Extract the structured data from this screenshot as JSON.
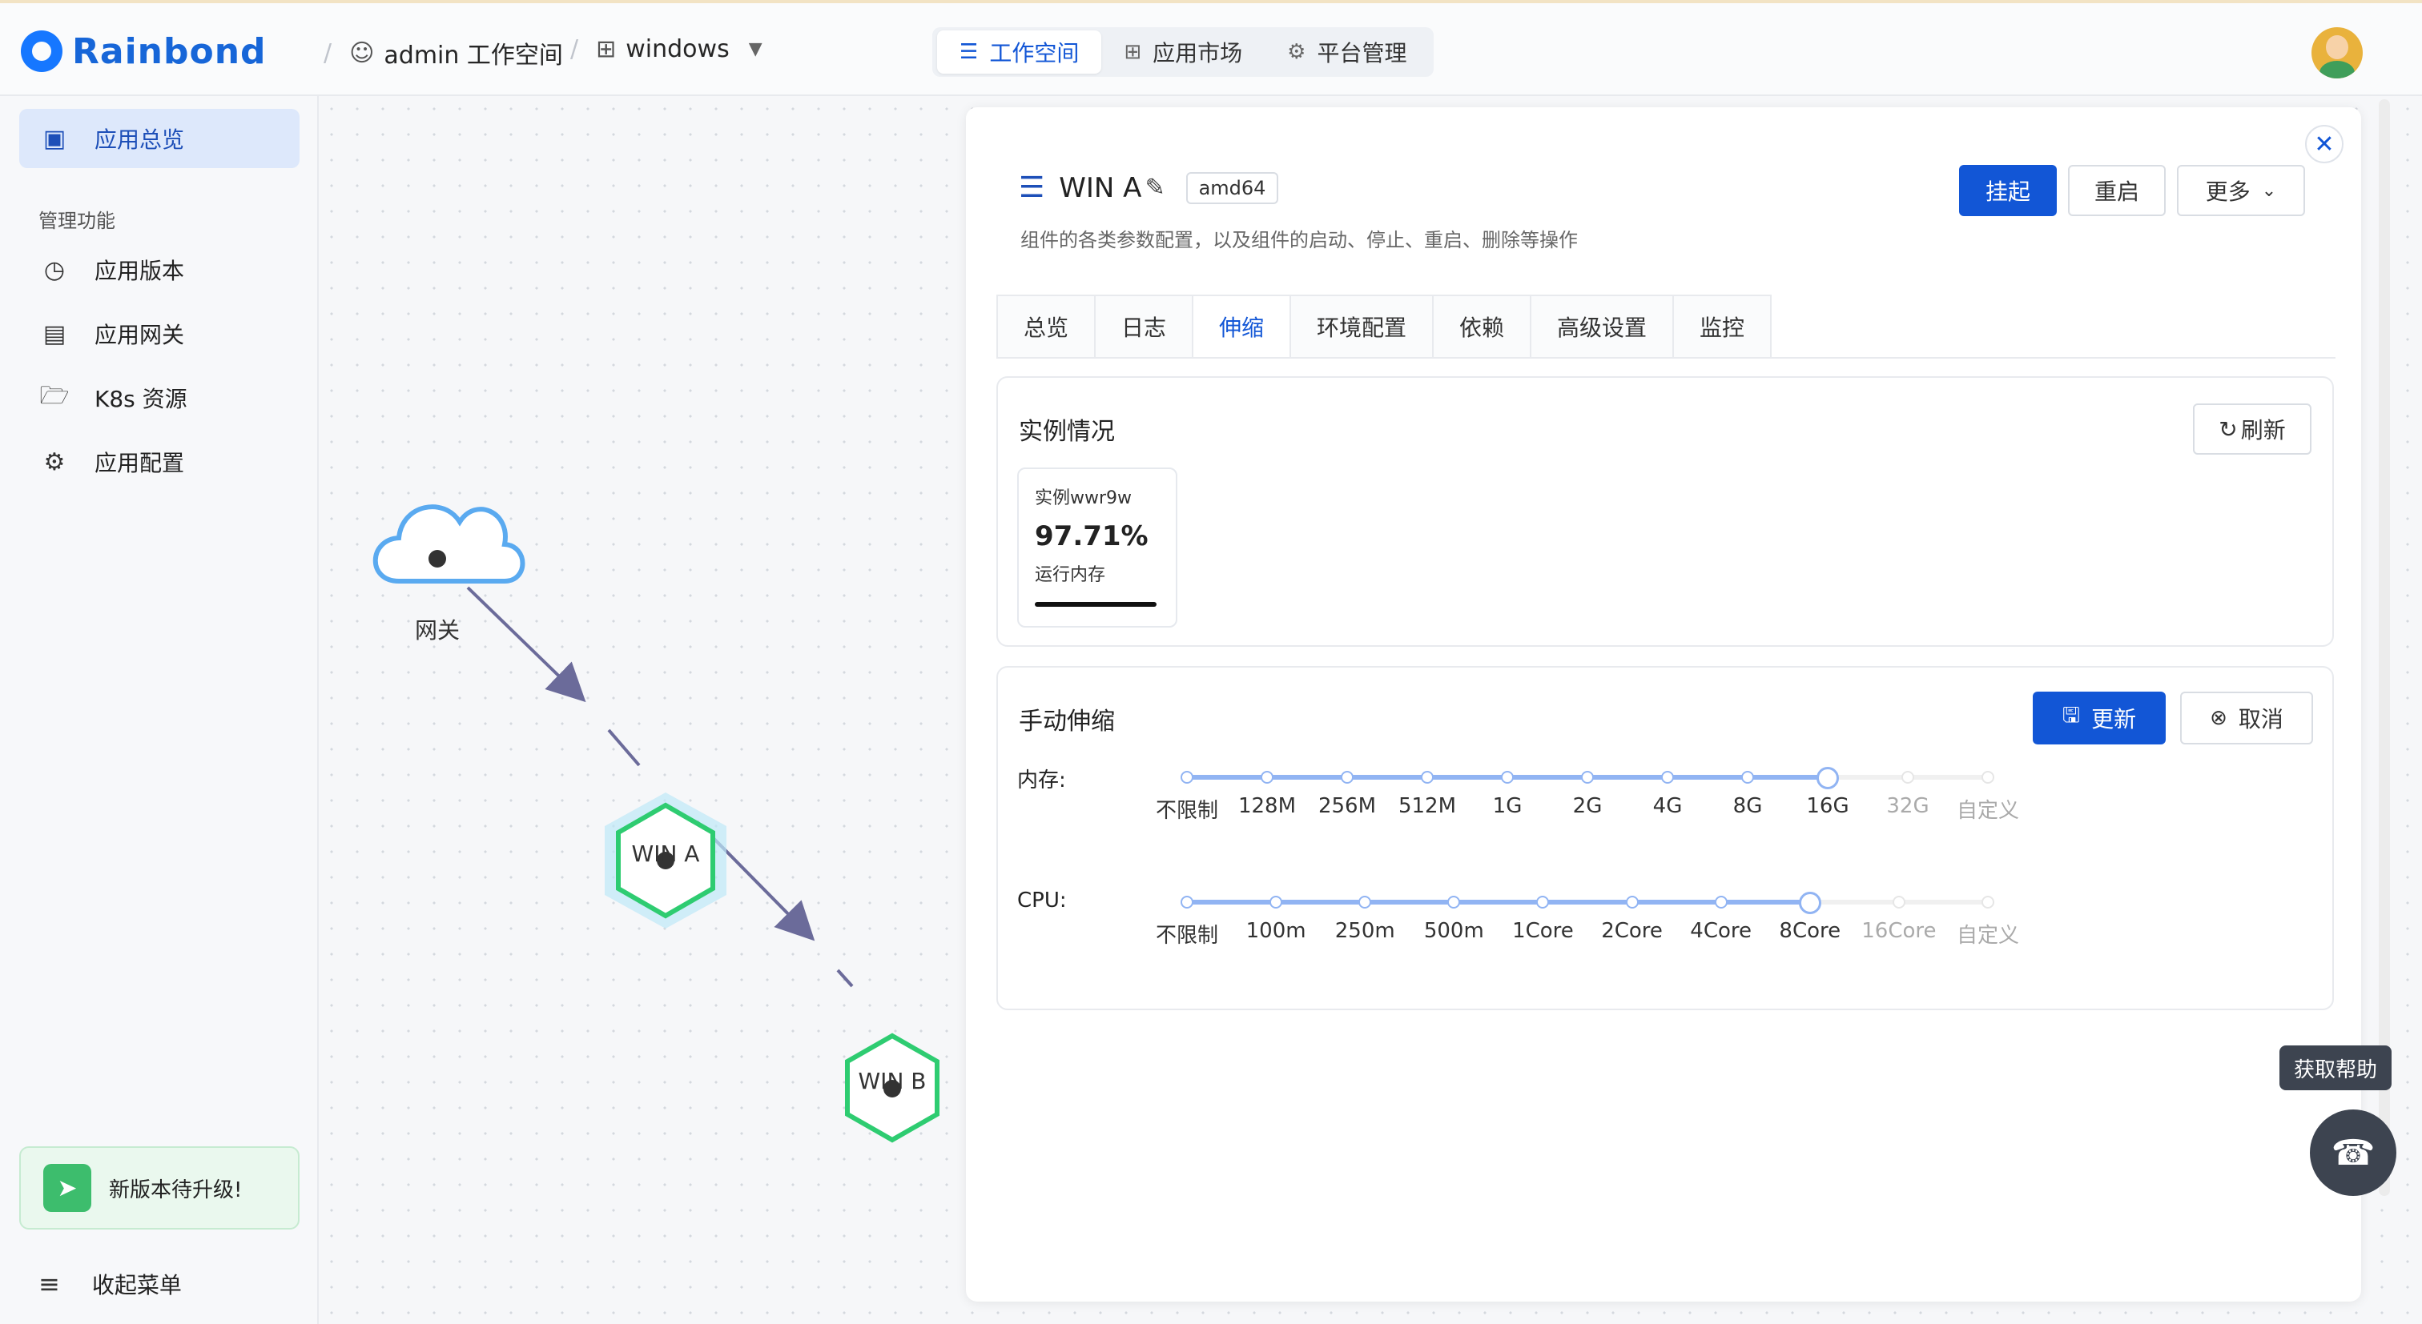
{
  "header": {
    "brand": "Rainbond",
    "workspace": "admin 工作空间",
    "app": "windows",
    "nav": [
      {
        "label": "工作空间",
        "icon": "layers-icon",
        "active": true
      },
      {
        "label": "应用市场",
        "icon": "grid-icon",
        "active": false
      },
      {
        "label": "平台管理",
        "icon": "gear-icon",
        "active": false
      }
    ]
  },
  "sidebar": {
    "overview": "应用总览",
    "section": "管理功能",
    "items": [
      "应用版本",
      "应用网关",
      "K8s 资源",
      "应用配置"
    ],
    "upgrade": "新版本待升级!",
    "collapse": "收起菜单"
  },
  "topology": {
    "nodes": [
      {
        "label": "网关",
        "type": "gateway"
      },
      {
        "label": "WIN A",
        "type": "component",
        "selected": true
      },
      {
        "label": "WIN B",
        "type": "component"
      }
    ]
  },
  "panel": {
    "title": "WIN A",
    "arch": "amd64",
    "subtitle": "组件的各类参数配置，以及组件的启动、停止、重启、删除等操作",
    "buttons": {
      "suspend": "挂起",
      "restart": "重启",
      "more": "更多"
    },
    "tabs": [
      "总览",
      "日志",
      "伸缩",
      "环境配置",
      "依赖",
      "高级设置",
      "监控"
    ],
    "active_tab": "伸缩",
    "instances": {
      "title": "实例情况",
      "refresh": "刷新",
      "list": [
        {
          "name": "实例wwr9w",
          "percent": "97.71%",
          "label": "运行内存"
        }
      ]
    },
    "manual": {
      "title": "手动伸缩",
      "update": "更新",
      "cancel": "取消",
      "memory": {
        "label": "内存:",
        "marks": [
          "不限制",
          "128M",
          "256M",
          "512M",
          "1G",
          "2G",
          "4G",
          "8G",
          "16G",
          "32G",
          "自定义"
        ],
        "selected_index": 8
      },
      "cpu": {
        "label": "CPU:",
        "marks": [
          "不限制",
          "100m",
          "250m",
          "500m",
          "1Core",
          "2Core",
          "4Core",
          "8Core",
          "16Core",
          "自定义"
        ],
        "selected_index": 7
      }
    }
  },
  "help": {
    "tooltip": "获取帮助"
  },
  "colors": {
    "primary": "#1256d6",
    "node_green": "#2ecc71",
    "gateway_blue": "#5aaaf0",
    "edge": "#6b6b9a"
  }
}
